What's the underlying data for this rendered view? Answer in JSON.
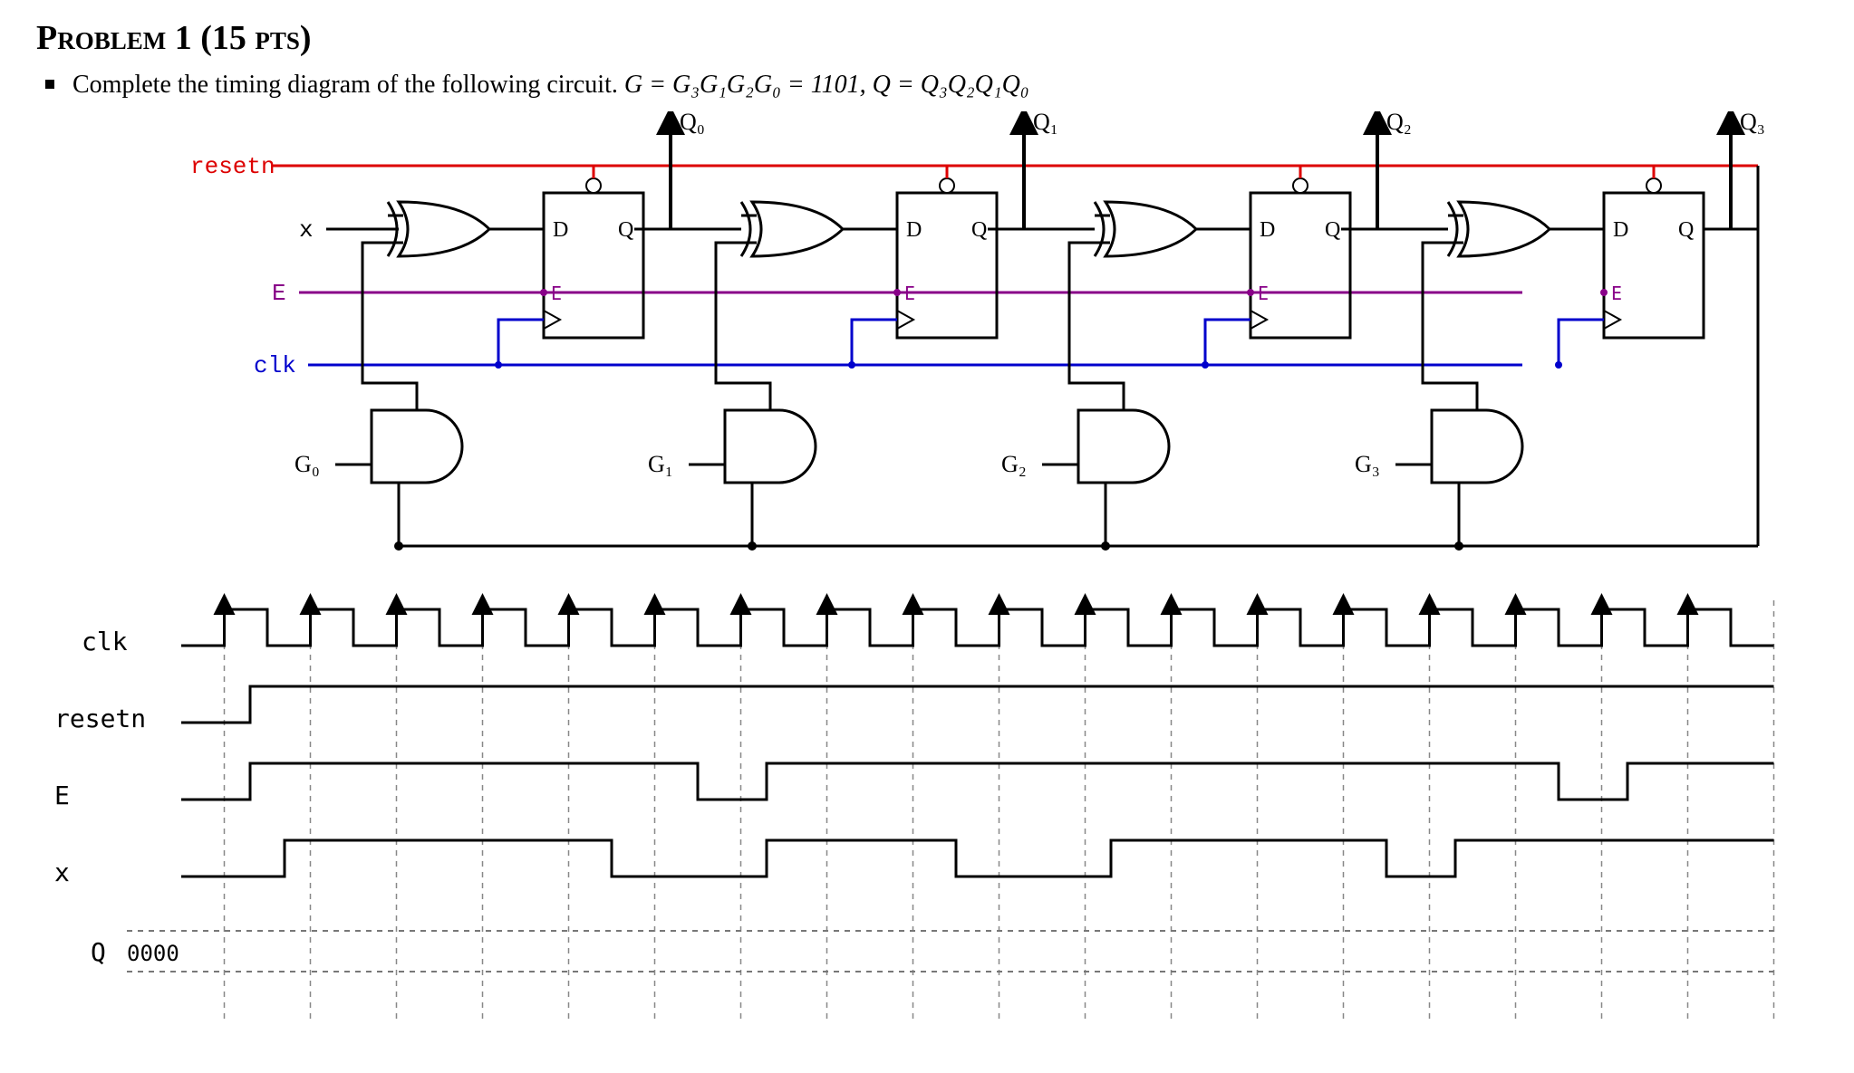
{
  "title": "Problem 1 (15 pts)",
  "statement_intro": "Complete the timing diagram of the following circuit. ",
  "equation_text": "G = G₃G₁G₂G₀ = 1101, Q = Q₃Q₂Q₁Q₀",
  "circuit": {
    "resetn_label": "resetn",
    "x_label": "x",
    "E_label": "E",
    "clk_label": "clk",
    "ff": [
      {
        "D": "D",
        "Q": "Q",
        "E": "E",
        "out": "Q₀",
        "Gin": "G₀"
      },
      {
        "D": "D",
        "Q": "Q",
        "E": "E",
        "out": "Q₁",
        "Gin": "G₁"
      },
      {
        "D": "D",
        "Q": "Q",
        "E": "E",
        "out": "Q₂",
        "Gin": "G₂"
      },
      {
        "D": "D",
        "Q": "Q",
        "E": "E",
        "out": "Q₃",
        "Gin": "G₃"
      }
    ],
    "G_value": "1101",
    "G_bits": {
      "G3": 1,
      "G2": 1,
      "G1": 0,
      "G0": 1
    }
  },
  "timing": {
    "signals": [
      "clk",
      "resetn",
      "E",
      "x",
      "Q"
    ],
    "clk_label": "clk",
    "resetn_label": "resetn",
    "E_label": "E",
    "x_label": "x",
    "Q_label": "Q",
    "Q_init": "0000",
    "num_edges": 18,
    "resetn_high_after_edge": 0.3,
    "E_segments": [
      {
        "from": 0.3,
        "to": 5.5,
        "level": 1
      },
      {
        "from": 5.5,
        "to": 6.3,
        "level": 0
      },
      {
        "from": 6.3,
        "to": 15.5,
        "level": 1
      },
      {
        "from": 15.5,
        "to": 16.3,
        "level": 0
      },
      {
        "from": 16.3,
        "to": 18,
        "level": 1
      }
    ],
    "x_segments": [
      {
        "from": 0.7,
        "to": 4.5,
        "level": 1
      },
      {
        "from": 4.5,
        "to": 6.3,
        "level": 0
      },
      {
        "from": 6.3,
        "to": 8.5,
        "level": 1
      },
      {
        "from": 8.5,
        "to": 10.3,
        "level": 0
      },
      {
        "from": 10.3,
        "to": 13.5,
        "level": 1
      },
      {
        "from": 13.5,
        "to": 14.3,
        "level": 0
      },
      {
        "from": 14.3,
        "to": 18,
        "level": 1
      }
    ]
  }
}
